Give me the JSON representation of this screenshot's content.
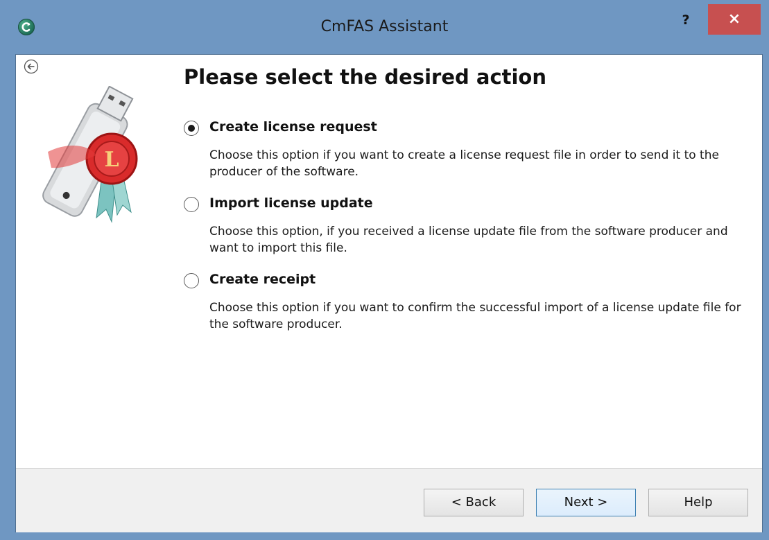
{
  "window": {
    "title": "CmFAS Assistant",
    "help_glyph": "?",
    "close_glyph": "×"
  },
  "icons": {
    "app": "cmfas-app-icon",
    "back": "back-arrow-icon",
    "logo": "usb-license-logo",
    "close": "close-icon",
    "help": "help-icon"
  },
  "main": {
    "heading": "Please select the desired action",
    "options": [
      {
        "label": "Create license request",
        "description": "Choose this option if you want to create a license request file in order to send it to the producer of the software.",
        "selected": true
      },
      {
        "label": "Import license update",
        "description": "Choose this option, if you received a license update file from the software producer and want to import this file.",
        "selected": false
      },
      {
        "label": "Create receipt",
        "description": "Choose this option if you want to confirm the successful import of a license update file for the software producer.",
        "selected": false
      }
    ]
  },
  "footer": {
    "back_label": "< Back",
    "next_label": "Next >",
    "help_label": "Help"
  },
  "colors": {
    "titlebar": "#6f97c2",
    "close_button": "#c75050",
    "footer": "#f0f0f0"
  }
}
